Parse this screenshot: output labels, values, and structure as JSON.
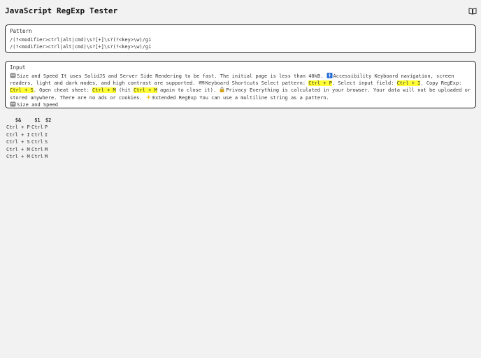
{
  "header": {
    "title": "JavaScript RegExp Tester",
    "cheat_sheet_icon": "book-icon"
  },
  "pattern": {
    "label": "Pattern",
    "lines": [
      "/(?<modifier>ctrl|alt|cmd)\\s?[+]\\s?(?<key>\\w)/gi",
      "/(?<modifier>ctrl|alt|cmd)\\s?[+]\\s?(?<key>\\w)/gi"
    ]
  },
  "input": {
    "label": "Input",
    "segments": {
      "s1": "Size and Speed It uses SolidJS and Server Side Rendering to be fast. The initial page is less than 40kB. ",
      "s2": "Accessibility Keyboard navigation, screen readers, light and dark modes, and high contrast are supported. ",
      "s3": "Keyboard Shortcuts Select pattern: ",
      "h1": "Ctrl + P",
      "s4": ". Select input field: ",
      "h2": "Ctrl + I",
      "s5": ". Copy RegExp: ",
      "h3": "Ctrl + S",
      "s6": ". Open cheat sheet: ",
      "h4": "Ctrl + M",
      "s7": " (hit ",
      "h5": "Ctrl + M",
      "s8": " again to close it). ",
      "s9": "Privacy Everything is calculated in your browser. Your data will not be uploaded or stored anywhere. There are no ads or cookies. ",
      "s10": "Extended RegExp You can use a multiline string as a pattern.",
      "s11": "Size and Speed"
    },
    "icons": [
      "rocket-icon",
      "accessibility-icon",
      "keyboard-icon",
      "lock-icon",
      "sparkle-icon",
      "rocket-icon"
    ]
  },
  "results": {
    "headers": [
      "$&",
      "$1",
      "$2"
    ],
    "rows": [
      [
        "Ctrl + P",
        "Ctrl",
        "P"
      ],
      [
        "Ctrl + I",
        "Ctrl",
        "I"
      ],
      [
        "Ctrl + S",
        "Ctrl",
        "S"
      ],
      [
        "Ctrl + M",
        "Ctrl",
        "M"
      ],
      [
        "Ctrl + M",
        "Ctrl",
        "M"
      ]
    ]
  },
  "colors": {
    "highlight": "#ffff33",
    "background": "#f2f2f2",
    "panel_border": "#222222"
  }
}
